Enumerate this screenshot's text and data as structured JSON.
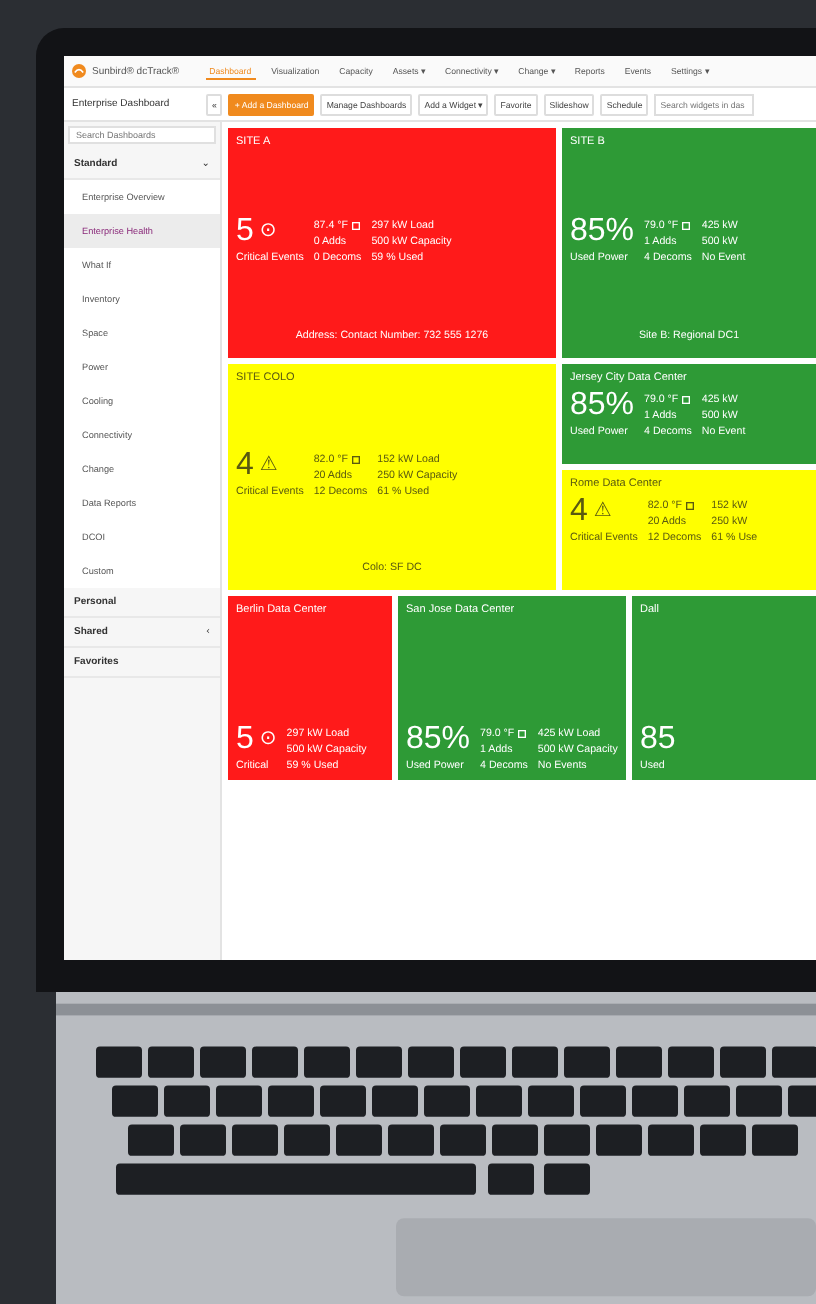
{
  "app": {
    "brand": "Sunbird® dcTrack®",
    "nav": [
      {
        "label": "Dashboard",
        "selected": true
      },
      {
        "label": "Visualization",
        "selected": false
      },
      {
        "label": "Capacity",
        "selected": false
      },
      {
        "label": "Assets ▾",
        "selected": false
      },
      {
        "label": "Connectivity ▾",
        "selected": false
      },
      {
        "label": "Change ▾",
        "selected": false
      },
      {
        "label": "Reports",
        "selected": false
      },
      {
        "label": "Events",
        "selected": false
      },
      {
        "label": "Settings ▾",
        "selected": false
      }
    ]
  },
  "toolbar": {
    "title": "Enterprise Dashboard",
    "collapse": "«",
    "buttons": [
      {
        "label": "+ Add a Dashboard",
        "kind": "primary"
      },
      {
        "label": "Manage Dashboards",
        "kind": "plain"
      },
      {
        "label": "Add a Widget ▾",
        "kind": "plain"
      },
      {
        "label": "Favorite",
        "kind": "plain"
      },
      {
        "label": "Slideshow",
        "kind": "plain"
      },
      {
        "label": "Schedule",
        "kind": "plain"
      }
    ],
    "search_placeholder": "Search widgets in das"
  },
  "sidebar": {
    "search_placeholder": "Search Dashboards",
    "groups": [
      {
        "label": "Standard",
        "chevron": "⌄",
        "children": [
          {
            "label": "Enterprise Overview",
            "selected": false
          },
          {
            "label": "Enterprise Health",
            "selected": true
          },
          {
            "label": "What If",
            "selected": false
          },
          {
            "label": "Inventory",
            "selected": false
          },
          {
            "label": "Space",
            "selected": false
          },
          {
            "label": "Power",
            "selected": false
          },
          {
            "label": "Cooling",
            "selected": false
          },
          {
            "label": "Connectivity",
            "selected": false
          },
          {
            "label": "Change",
            "selected": false
          },
          {
            "label": "Data Reports",
            "selected": false
          },
          {
            "label": "DCOI",
            "selected": false
          },
          {
            "label": "Custom",
            "selected": false
          }
        ]
      },
      {
        "label": "Personal"
      },
      {
        "label": "Shared",
        "chevron": "‹"
      },
      {
        "label": "Favorites"
      }
    ]
  },
  "tiles": [
    {
      "title": "SITE A",
      "color": "#ff1a1a",
      "value": "5",
      "icon": "⊙",
      "label": "Critical Events",
      "sensor": true,
      "stats": [
        [
          "87.4 °F",
          "0 Adds",
          "0 Decoms"
        ],
        [
          "297 kW Load",
          "500 kW Capacity",
          "59 % Used"
        ]
      ],
      "footer": "Address: Contact Number: 732 555 1276"
    },
    {
      "title": "SITE B",
      "color": "#2e9a36",
      "value": "85%",
      "label": "Used Power",
      "sensor": true,
      "stats": [
        [
          "79.0 °F",
          "1 Adds",
          "4 Decoms"
        ],
        [
          "425 kW",
          "500 kW",
          "No Event"
        ]
      ],
      "footer": "Site B: Regional DC1"
    },
    {
      "title": "SITE COLO",
      "color": "#ffff00",
      "value": "4",
      "icon": "⚠",
      "label": "Critical Events",
      "sensor": true,
      "stats": [
        [
          "82.0 °F",
          "20 Adds",
          "12 Decoms"
        ],
        [
          "152 kW Load",
          "250 kW Capacity",
          "61 % Used"
        ]
      ],
      "footer": "Colo: SF DC"
    },
    {
      "title": "Jersey City Data Center",
      "color": "#2e9a36",
      "value": "85%",
      "label": "Used Power",
      "sensor": true,
      "stats": [
        [
          "79.0 °F",
          "1 Adds",
          "4 Decoms"
        ],
        [
          "425 kW",
          "500 kW",
          "No Event"
        ]
      ]
    },
    {
      "title": "Rome Data Center",
      "color": "#ffff00",
      "value": "4",
      "icon": "⚠",
      "label": "Critical Events",
      "sensor": true,
      "stats": [
        [
          "82.0 °F",
          "20 Adds",
          "12 Decoms"
        ],
        [
          "152 kW",
          "250 kW",
          "61 % Use"
        ]
      ]
    },
    {
      "title": "Berlin Data Center",
      "color": "#ff1a1a",
      "value": "5",
      "icon": "⊙",
      "label": "Critical",
      "sensor": false,
      "stats": [
        [
          "297 kW Load",
          "500 kW Capacity",
          "59 % Used"
        ]
      ]
    },
    {
      "title": "San Jose Data Center",
      "color": "#2e9a36",
      "value": "85%",
      "label": "Used Power",
      "sensor": true,
      "stats": [
        [
          "79.0 °F",
          "1 Adds",
          "4 Decoms"
        ],
        [
          "425 kW Load",
          "500 kW Capacity",
          "No Events"
        ]
      ]
    },
    {
      "title": "Dall",
      "color": "#2e9a36",
      "value": "85",
      "label": "Used"
    }
  ]
}
